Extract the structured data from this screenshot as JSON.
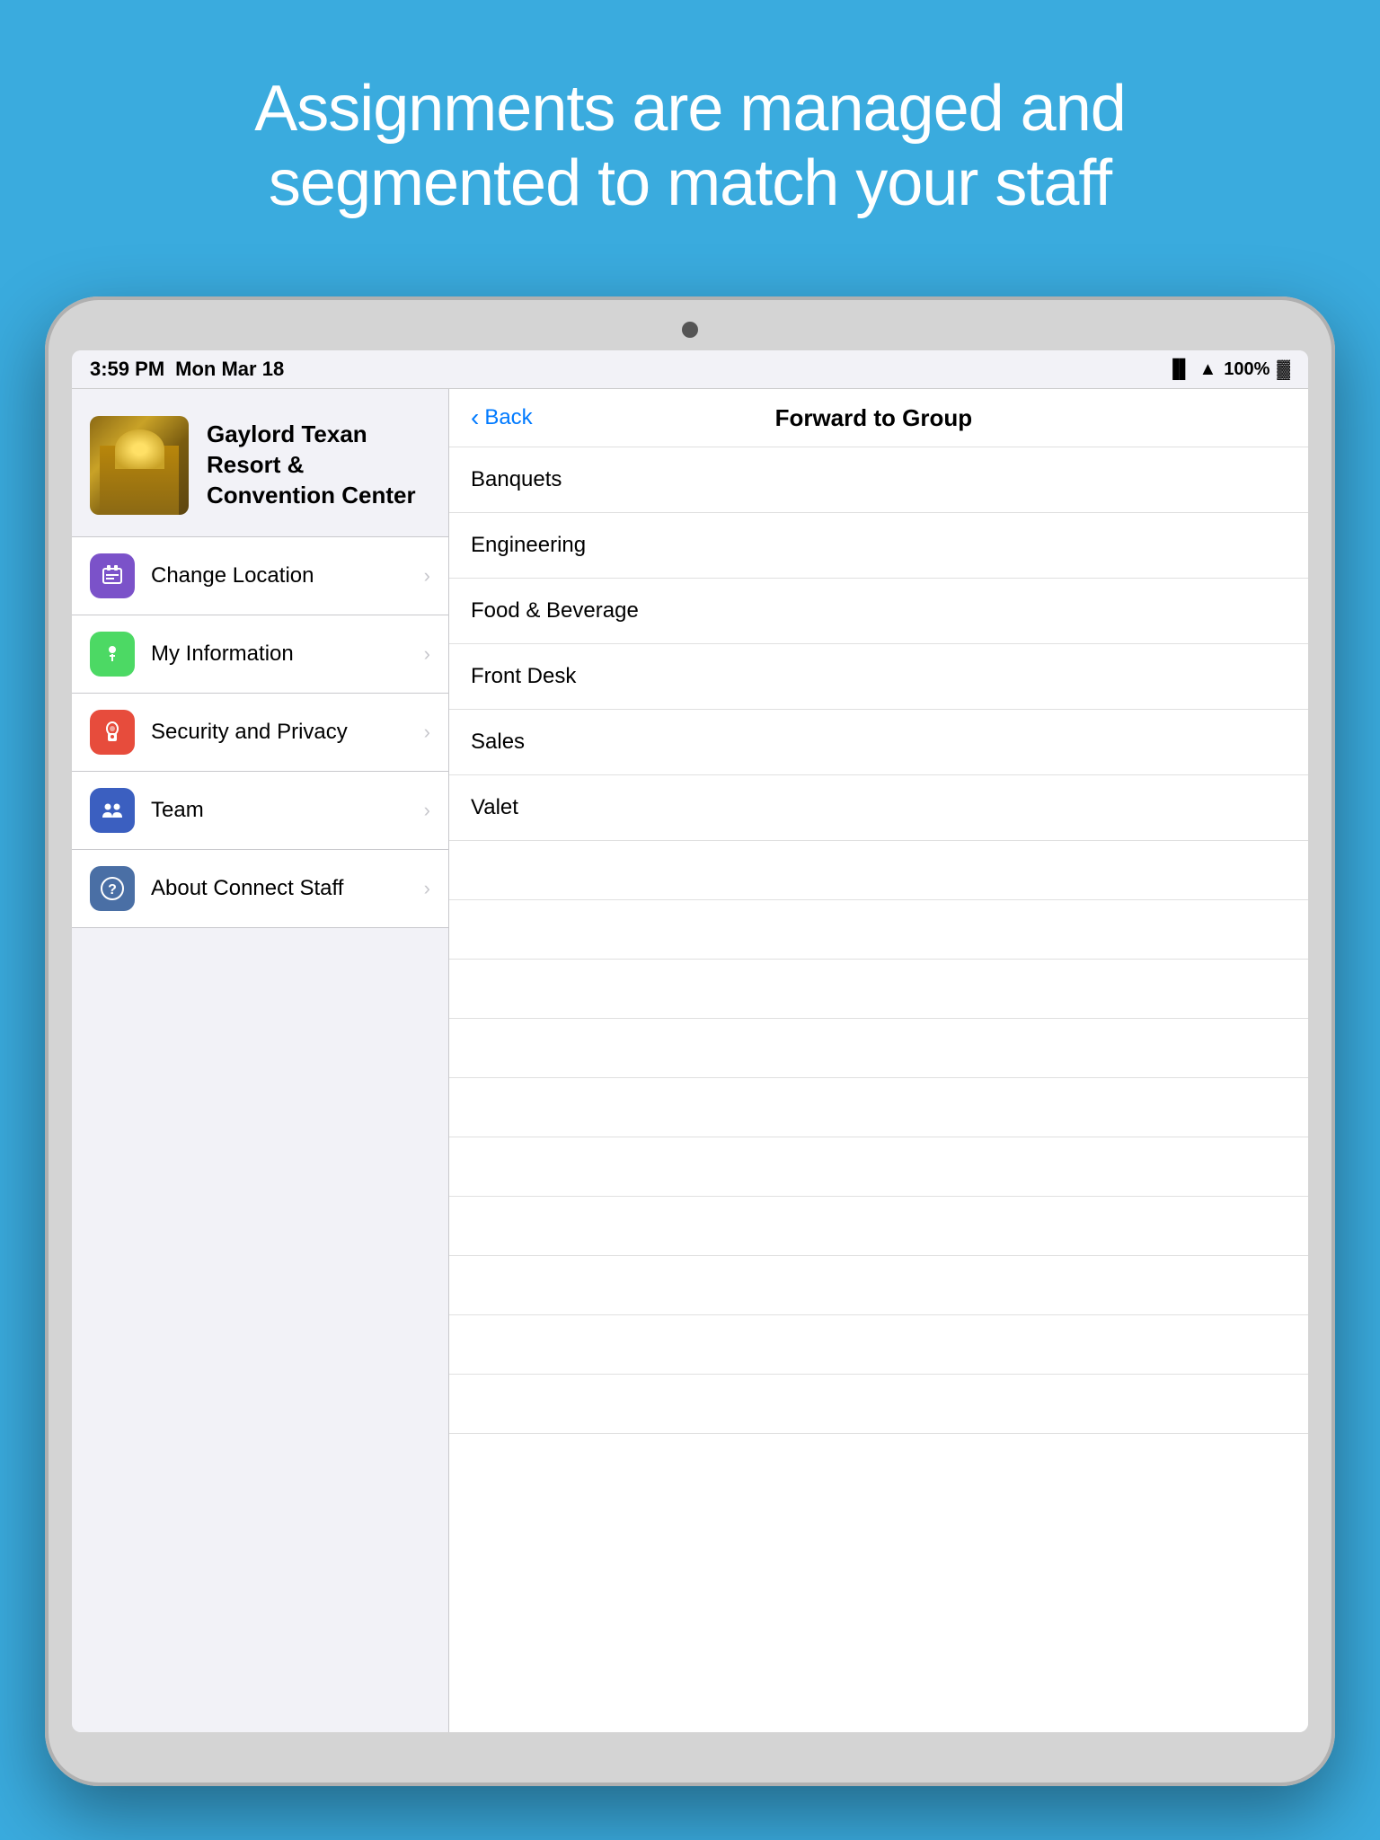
{
  "headline": {
    "line1": "Assignments are managed and",
    "line2": "segmented to match your staff"
  },
  "status_bar": {
    "time": "3:59 PM",
    "date": "Mon Mar 18",
    "battery": "100%",
    "signal": "●●",
    "wifi": "WiFi"
  },
  "hotel": {
    "name": "Gaylord Texan Resort & Convention Center"
  },
  "menu": {
    "items": [
      {
        "id": "change-location",
        "label": "Change Location",
        "icon_color": "purple",
        "icon": "🏢"
      },
      {
        "id": "my-information",
        "label": "My Information",
        "icon_color": "green",
        "icon": "ℹ"
      },
      {
        "id": "security-privacy",
        "label": "Security and Privacy",
        "icon_color": "red",
        "icon": "👆"
      },
      {
        "id": "team",
        "label": "Team",
        "icon_color": "blue-dark",
        "icon": "👥"
      },
      {
        "id": "about-connect-staff",
        "label": "About Connect Staff",
        "icon_color": "blue-gray",
        "icon": "?"
      }
    ]
  },
  "right_panel": {
    "nav": {
      "back_label": "Back",
      "title": "Forward to Group"
    },
    "groups": [
      "Banquets",
      "Engineering",
      "Food & Beverage",
      "Front Desk",
      "Sales",
      "Valet"
    ],
    "empty_rows": 10
  }
}
